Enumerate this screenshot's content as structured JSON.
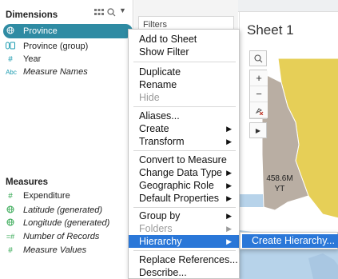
{
  "data_pane": {
    "dimensions_header": "Dimensions",
    "measures_header": "Measures",
    "dimensions": [
      {
        "label": "Province",
        "icon": "globe-icon",
        "italic": false
      },
      {
        "label": "Province (group)",
        "icon": "paperclip-group-icon",
        "italic": false
      },
      {
        "label": "Year",
        "icon": "hash-icon",
        "italic": false
      },
      {
        "label": "Measure Names",
        "icon": "abc-icon",
        "italic": true
      }
    ],
    "measures": [
      {
        "label": "Expenditure",
        "icon": "hash-icon",
        "italic": false
      },
      {
        "label": "Latitude (generated)",
        "icon": "globe-icon",
        "italic": true
      },
      {
        "label": "Longitude (generated)",
        "icon": "globe-icon",
        "italic": true
      },
      {
        "label": "Number of Records",
        "icon": "hash-icon",
        "italic": true
      },
      {
        "label": "Measure Values",
        "icon": "hash-icon",
        "italic": true
      }
    ],
    "icon_abc": "Abc"
  },
  "filters_label": "Filters",
  "sheet": {
    "title": "Sheet 1",
    "map_label_value": "458.6M",
    "map_label_region": "YT"
  },
  "context_menu": {
    "items": [
      {
        "label": "Add to Sheet",
        "arrow": false,
        "disabled": false
      },
      {
        "label": "Show Filter",
        "arrow": false,
        "disabled": false
      },
      {
        "label": "Duplicate",
        "arrow": false,
        "disabled": false
      },
      {
        "label": "Rename",
        "arrow": false,
        "disabled": false
      },
      {
        "label": "Hide",
        "arrow": false,
        "disabled": true
      },
      {
        "label": "Aliases...",
        "arrow": false,
        "disabled": false
      },
      {
        "label": "Create",
        "arrow": true,
        "disabled": false
      },
      {
        "label": "Transform",
        "arrow": true,
        "disabled": false
      },
      {
        "label": "Convert to Measure",
        "arrow": false,
        "disabled": false
      },
      {
        "label": "Change Data Type",
        "arrow": true,
        "disabled": false
      },
      {
        "label": "Geographic Role",
        "arrow": true,
        "disabled": false
      },
      {
        "label": "Default Properties",
        "arrow": true,
        "disabled": false
      },
      {
        "label": "Group by",
        "arrow": true,
        "disabled": false
      },
      {
        "label": "Folders",
        "arrow": true,
        "disabled": true
      },
      {
        "label": "Hierarchy",
        "arrow": true,
        "disabled": false,
        "highlighted": true
      },
      {
        "label": "Replace References...",
        "arrow": false,
        "disabled": false
      },
      {
        "label": "Describe...",
        "arrow": false,
        "disabled": false
      }
    ],
    "arrow_glyph": "▶"
  },
  "submenu": {
    "label": "Create Hierarchy..."
  },
  "colors": {
    "selected_pill": "#2f8ba3",
    "menu_highlight": "#2a77d8",
    "dimension_icon": "#1b9bb0",
    "measure_icon": "#34a853",
    "map_yellow": "#e6cf57",
    "map_taupe": "#b9aea3",
    "map_blue": "#b7d3ea"
  }
}
